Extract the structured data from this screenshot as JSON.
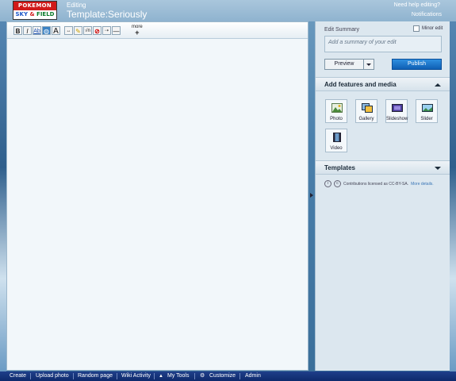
{
  "header": {
    "logo_top": "POKEMON",
    "logo_sky": "SKY",
    "logo_amp": "&",
    "logo_field": "FIELD",
    "editing_label": "Editing",
    "page_title": "Template:Seriously",
    "help_link": "Need help editing?",
    "notifications": "Notifications"
  },
  "toolbar": {
    "buttons": [
      "B",
      "I",
      "Ab",
      "globe",
      "A",
      "sig",
      "pen",
      "√n",
      "no-wiki",
      "hr",
      "line"
    ],
    "more_label": "more",
    "more_plus": "+"
  },
  "panel": {
    "edit_summary_label": "Edit Summary",
    "minor_edit_label": "Minor edit",
    "summary_placeholder": "Add a summary of your edit",
    "preview_label": "Preview",
    "publish_label": "Publish",
    "features_title": "Add features and media",
    "media": [
      {
        "label": "Photo",
        "icon": "photo-icon"
      },
      {
        "label": "Gallery",
        "icon": "gallery-icon"
      },
      {
        "label": "Slideshow",
        "icon": "slideshow-icon"
      },
      {
        "label": "Slider",
        "icon": "slider-icon"
      },
      {
        "label": "Video",
        "icon": "video-icon"
      }
    ],
    "templates_title": "Templates",
    "license_text": "Contributions licensed as CC-BY-SA.",
    "license_more": "More details."
  },
  "bottombar": {
    "items": [
      "Create",
      "Upload photo",
      "Random page",
      "Wiki Activity",
      "My Tools",
      "Customize",
      "Admin"
    ]
  },
  "colors": {
    "publish": "#1a6fc8",
    "bottombar": "#14327a",
    "header": "#9dbdd6"
  }
}
